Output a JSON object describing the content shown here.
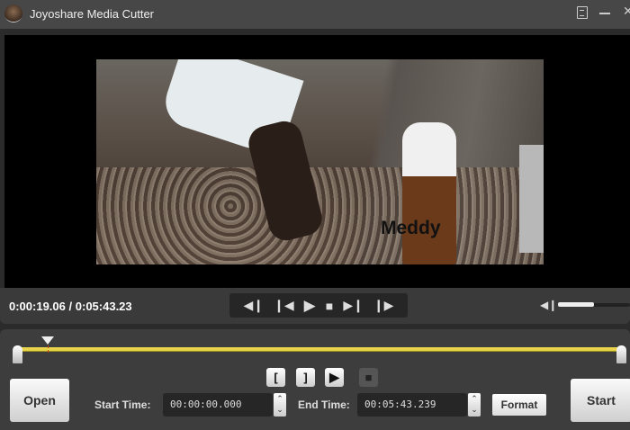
{
  "window": {
    "title": "Joyoshare Media Cutter",
    "menu_icon": "menu-icon",
    "minimize_icon": "minimize-icon",
    "close_icon": "close-icon"
  },
  "video": {
    "overlay_text": "Meddy"
  },
  "player": {
    "current_time": "0:00:19.06",
    "separator": "/",
    "duration": "0:05:43.23",
    "volume_percent": 50
  },
  "transport": {
    "icons": [
      "prev-segment-icon",
      "prev-frame-icon",
      "play-icon",
      "stop-icon",
      "next-frame-icon",
      "next-segment-icon"
    ]
  },
  "timeline": {
    "playhead_percent": 5.5,
    "selection_start_percent": 0,
    "selection_end_percent": 100,
    "colors": {
      "selection": "#e8d44a"
    }
  },
  "segment_controls": {
    "set_start": "[",
    "set_end": "]"
  },
  "buttons": {
    "open": "Open",
    "start": "Start",
    "format": "Format"
  },
  "start_time": {
    "label": "Start Time:",
    "value": "00:00:00.000"
  },
  "end_time": {
    "label": "End Time:",
    "value": "00:05:43.239"
  }
}
